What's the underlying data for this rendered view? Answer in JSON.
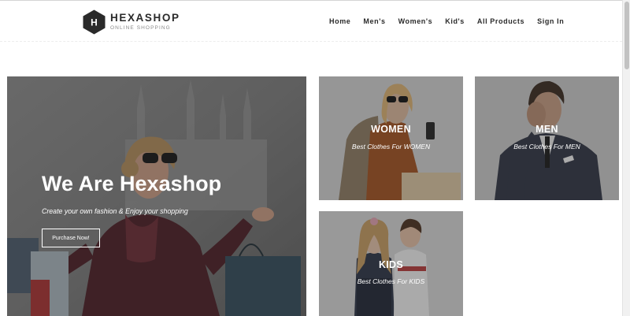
{
  "header": {
    "logo": {
      "brand": "HEXASHOP",
      "tagline": "ONLINE SHOPPING",
      "mark": "H"
    },
    "nav": [
      {
        "label": "Home"
      },
      {
        "label": "Men's"
      },
      {
        "label": "Women's"
      },
      {
        "label": "Kid's"
      },
      {
        "label": "All Products"
      },
      {
        "label": "Sign In"
      }
    ]
  },
  "hero": {
    "title": "We Are Hexashop",
    "subtitle": "Create your own fashion & Enjoy your shopping",
    "button_label": "Purchase Now!"
  },
  "categories": {
    "women": {
      "title": "WOMEN",
      "subtitle": "Best Clothes For WOMEN"
    },
    "men": {
      "title": "MEN",
      "subtitle": "Best Clothes For MEN"
    },
    "kids": {
      "title": "KIDS",
      "subtitle": "Best Clothes For KIDS"
    }
  },
  "colors": {
    "brand_dark": "#2a2a2a",
    "overlay": "#2b2b2b",
    "text_light": "#ffffff"
  }
}
